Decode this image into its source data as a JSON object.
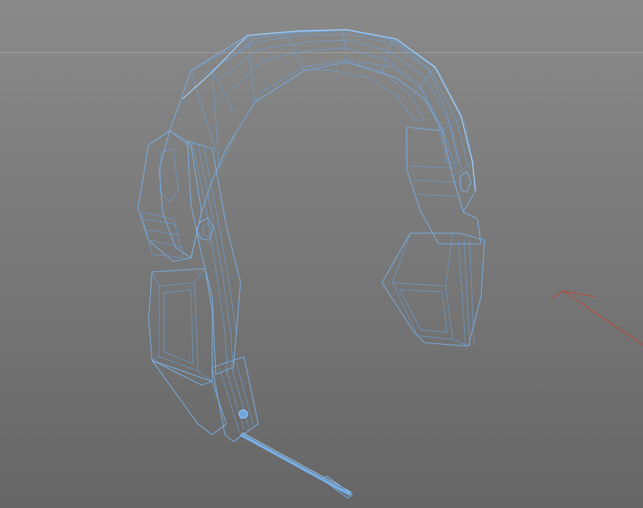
{
  "viewport": {
    "background_top": "#8a8a8a",
    "background_bottom": "#666666",
    "horizon_color": "#a9a9a9"
  },
  "model": {
    "wire_color": "#78b0e8",
    "face_dark": "#3d434a",
    "face_mid": "#4d545c",
    "face_light": "#5f666e",
    "inner_dark": "#22272c"
  },
  "axis": {
    "color": "#cc3a2a"
  }
}
